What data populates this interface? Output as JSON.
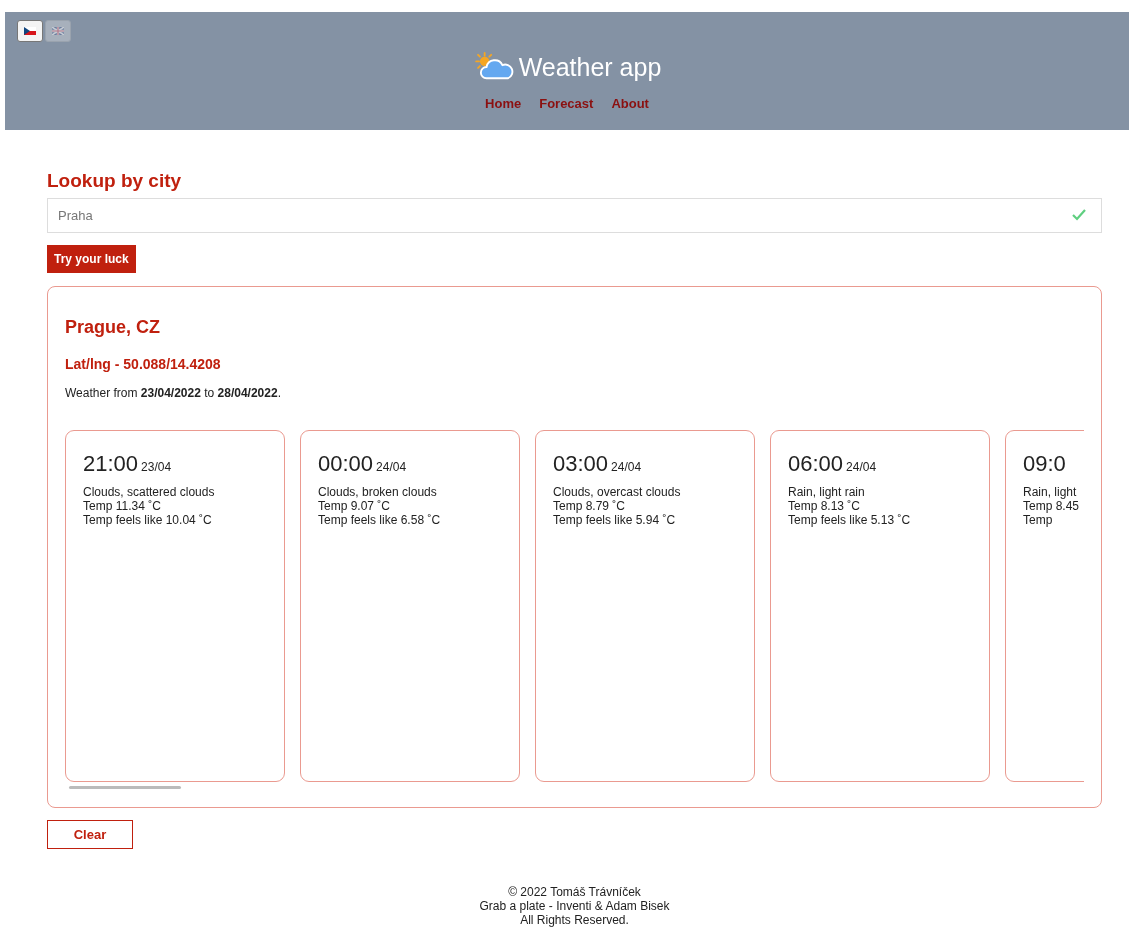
{
  "languages": [
    {
      "kind": "cz",
      "selected": true
    },
    {
      "kind": "gb",
      "selected": false
    }
  ],
  "header": {
    "title": "Weather app"
  },
  "nav": [
    {
      "label": "Home"
    },
    {
      "label": "Forecast"
    },
    {
      "label": "About"
    }
  ],
  "lookup": {
    "heading": "Lookup by city",
    "field": {
      "value": "Praha",
      "valid": true
    },
    "button": "Try your luck"
  },
  "result": {
    "city": "Prague, CZ",
    "coords": "Lat/lng - 50.088/14.4208",
    "range": "Weather from **23/04/2022** to **28/04/2022**.",
    "cards": [
      {
        "time": "21:00",
        "date": "23/04",
        "lines": [
          "Clouds, scattered clouds",
          "Temp 11.34 ˚C",
          "Temp feels like 10.04 ˚C"
        ]
      },
      {
        "time": "00:00",
        "date": "24/04",
        "lines": [
          "Clouds, broken clouds",
          "Temp 9.07 ˚C",
          "Temp feels like 6.58 ˚C"
        ]
      },
      {
        "time": "03:00",
        "date": "24/04",
        "lines": [
          "Clouds, overcast clouds",
          "Temp 8.79 ˚C",
          "Temp feels like 5.94 ˚C"
        ]
      },
      {
        "time": "06:00",
        "date": "24/04",
        "lines": [
          "Rain, light rain",
          "Temp 8.13 ˚C",
          "Temp feels like 5.13 ˚C"
        ]
      },
      {
        "time": "09:0",
        "lines": [
          "Rain, light",
          "Temp 8.45",
          "Temp"
        ]
      }
    ]
  },
  "clear_button": "Clear",
  "footer": [
    "© 2022 Tomáš Trávníček",
    "Grab a plate - Inventi & Adam Bisek",
    "All Rights Reserved."
  ]
}
